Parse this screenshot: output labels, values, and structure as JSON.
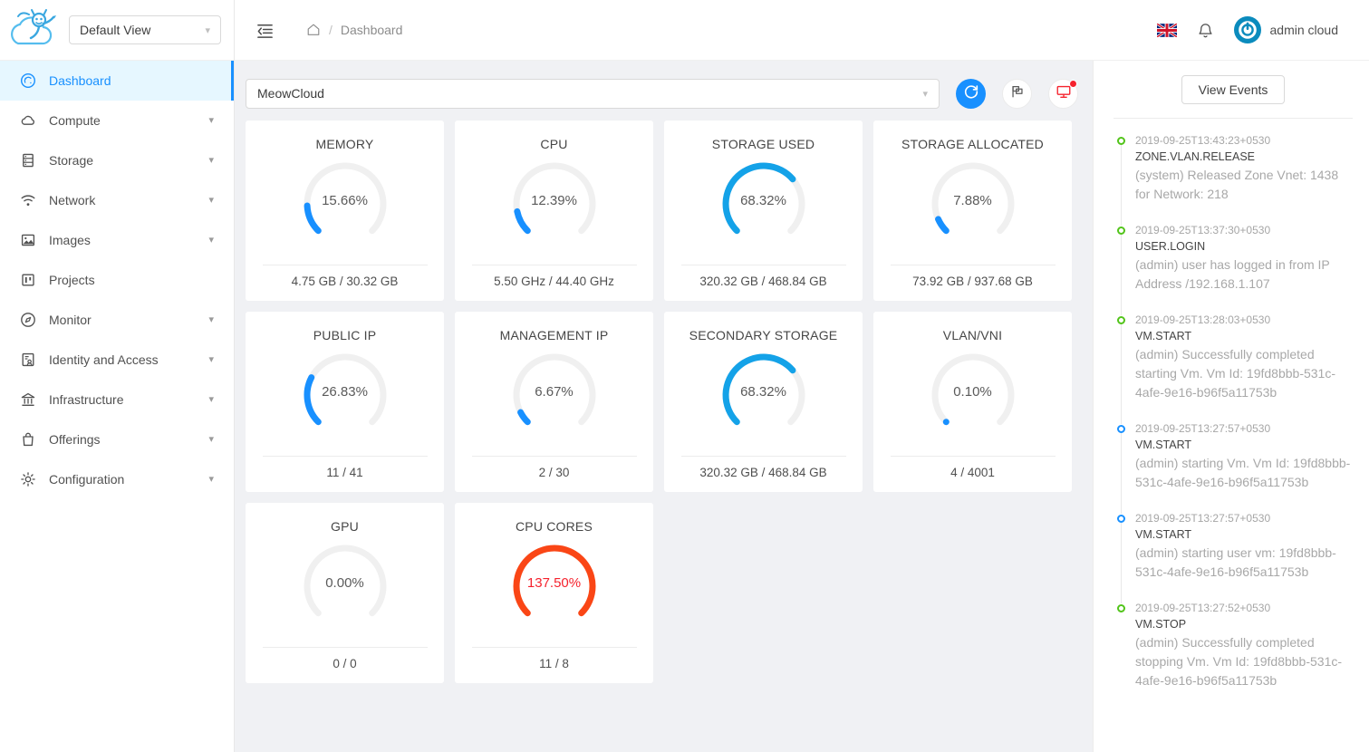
{
  "sidebar": {
    "view_selector": {
      "label": "Default View",
      "icon": "chevron-down-icon"
    },
    "items": [
      {
        "label": "Dashboard",
        "icon": "dashboard-icon",
        "active": true,
        "expandable": false
      },
      {
        "label": "Compute",
        "icon": "cloud-icon",
        "active": false,
        "expandable": true
      },
      {
        "label": "Storage",
        "icon": "database-icon",
        "active": false,
        "expandable": true
      },
      {
        "label": "Network",
        "icon": "wifi-icon",
        "active": false,
        "expandable": true
      },
      {
        "label": "Images",
        "icon": "picture-icon",
        "active": false,
        "expandable": true
      },
      {
        "label": "Projects",
        "icon": "project-icon",
        "active": false,
        "expandable": false
      },
      {
        "label": "Monitor",
        "icon": "compass-icon",
        "active": false,
        "expandable": true
      },
      {
        "label": "Identity and Access",
        "icon": "user-card-icon",
        "active": false,
        "expandable": true
      },
      {
        "label": "Infrastructure",
        "icon": "bank-icon",
        "active": false,
        "expandable": true
      },
      {
        "label": "Offerings",
        "icon": "shopping-bag-icon",
        "active": false,
        "expandable": true
      },
      {
        "label": "Configuration",
        "icon": "gear-icon",
        "active": false,
        "expandable": true
      }
    ]
  },
  "topbar": {
    "fold_icon": "menu-fold-icon",
    "home_icon": "home-icon",
    "breadcrumb_separator": "/",
    "breadcrumb_current": "Dashboard",
    "language_icon": "uk-flag-icon",
    "notification_icon": "bell-icon",
    "avatar_icon": "user-avatar-icon",
    "user_name": "admin cloud"
  },
  "toolbar": {
    "zone_selected": "MeowCloud",
    "zone_chevron": "chevron-down-icon",
    "refresh_icon": "refresh-icon",
    "project_icon": "flag-icon",
    "alert_icon": "monitor-icon",
    "alert_has_badge": true
  },
  "colors": {
    "accent": "#1890ff",
    "gauge_normal": "#1890ff",
    "gauge_bright": "#14a2e8",
    "gauge_danger": "#fa4616",
    "danger_text": "#f5222d",
    "track": "#f0f0f0",
    "event_success": "#52c41a",
    "event_info": "#1890ff",
    "content_bg": "#f0f1f4"
  },
  "chart_data": {
    "type": "gauge-grid",
    "title": "Zone capacity gauges",
    "arc_sweep_degrees": 270,
    "arc_start_angle_degrees": 135,
    "gauges": [
      {
        "title": "MEMORY",
        "percent": 15.66,
        "percent_label": "15.66%",
        "footer": "4.75 GB / 30.32 GB",
        "used": 4.75,
        "total": 30.32,
        "unit": "GB",
        "state": "normal"
      },
      {
        "title": "CPU",
        "percent": 12.39,
        "percent_label": "12.39%",
        "footer": "5.50 GHz / 44.40 GHz",
        "used": 5.5,
        "total": 44.4,
        "unit": "GHz",
        "state": "normal"
      },
      {
        "title": "STORAGE USED",
        "percent": 68.32,
        "percent_label": "68.32%",
        "footer": "320.32 GB / 468.84 GB",
        "used": 320.32,
        "total": 468.84,
        "unit": "GB",
        "state": "bright"
      },
      {
        "title": "STORAGE ALLOCATED",
        "percent": 7.88,
        "percent_label": "7.88%",
        "footer": "73.92 GB / 937.68 GB",
        "used": 73.92,
        "total": 937.68,
        "unit": "GB",
        "state": "normal"
      },
      {
        "title": "PUBLIC IP",
        "percent": 26.83,
        "percent_label": "26.83%",
        "footer": "11 / 41",
        "used": 11,
        "total": 41,
        "unit": "",
        "state": "normal"
      },
      {
        "title": "MANAGEMENT IP",
        "percent": 6.67,
        "percent_label": "6.67%",
        "footer": "2 / 30",
        "used": 2,
        "total": 30,
        "unit": "",
        "state": "normal"
      },
      {
        "title": "SECONDARY STORAGE",
        "percent": 68.32,
        "percent_label": "68.32%",
        "footer": "320.32 GB / 468.84 GB",
        "used": 320.32,
        "total": 468.84,
        "unit": "GB",
        "state": "bright"
      },
      {
        "title": "VLAN/VNI",
        "percent": 0.1,
        "percent_label": "0.10%",
        "footer": "4 / 4001",
        "used": 4,
        "total": 4001,
        "unit": "",
        "state": "normal"
      },
      {
        "title": "GPU",
        "percent": 0.0,
        "percent_label": "0.00%",
        "footer": "0 / 0",
        "used": 0,
        "total": 0,
        "unit": "",
        "state": "empty"
      },
      {
        "title": "CPU CORES",
        "percent": 137.5,
        "percent_label": "137.50%",
        "footer": "11 / 8",
        "used": 11,
        "total": 8,
        "unit": "",
        "state": "danger"
      }
    ]
  },
  "events": {
    "view_events_label": "View Events",
    "items": [
      {
        "timestamp": "2019-09-25T13:43:23+0530",
        "type": "ZONE.VLAN.RELEASE",
        "description": "(system) Released Zone Vnet: 1438 for Network: 218",
        "status": "success"
      },
      {
        "timestamp": "2019-09-25T13:37:30+0530",
        "type": "USER.LOGIN",
        "description": "(admin) user has logged in from IP Address /192.168.1.107",
        "status": "success"
      },
      {
        "timestamp": "2019-09-25T13:28:03+0530",
        "type": "VM.START",
        "description": "(admin) Successfully completed starting Vm. Vm Id: 19fd8bbb-531c-4afe-9e16-b96f5a11753b",
        "status": "success"
      },
      {
        "timestamp": "2019-09-25T13:27:57+0530",
        "type": "VM.START",
        "description": "(admin) starting Vm. Vm Id: 19fd8bbb-531c-4afe-9e16-b96f5a11753b",
        "status": "info"
      },
      {
        "timestamp": "2019-09-25T13:27:57+0530",
        "type": "VM.START",
        "description": "(admin) starting user vm: 19fd8bbb-531c-4afe-9e16-b96f5a11753b",
        "status": "info"
      },
      {
        "timestamp": "2019-09-25T13:27:52+0530",
        "type": "VM.STOP",
        "description": "(admin) Successfully completed stopping Vm. Vm Id: 19fd8bbb-531c-4afe-9e16-b96f5a11753b",
        "status": "success"
      }
    ]
  }
}
